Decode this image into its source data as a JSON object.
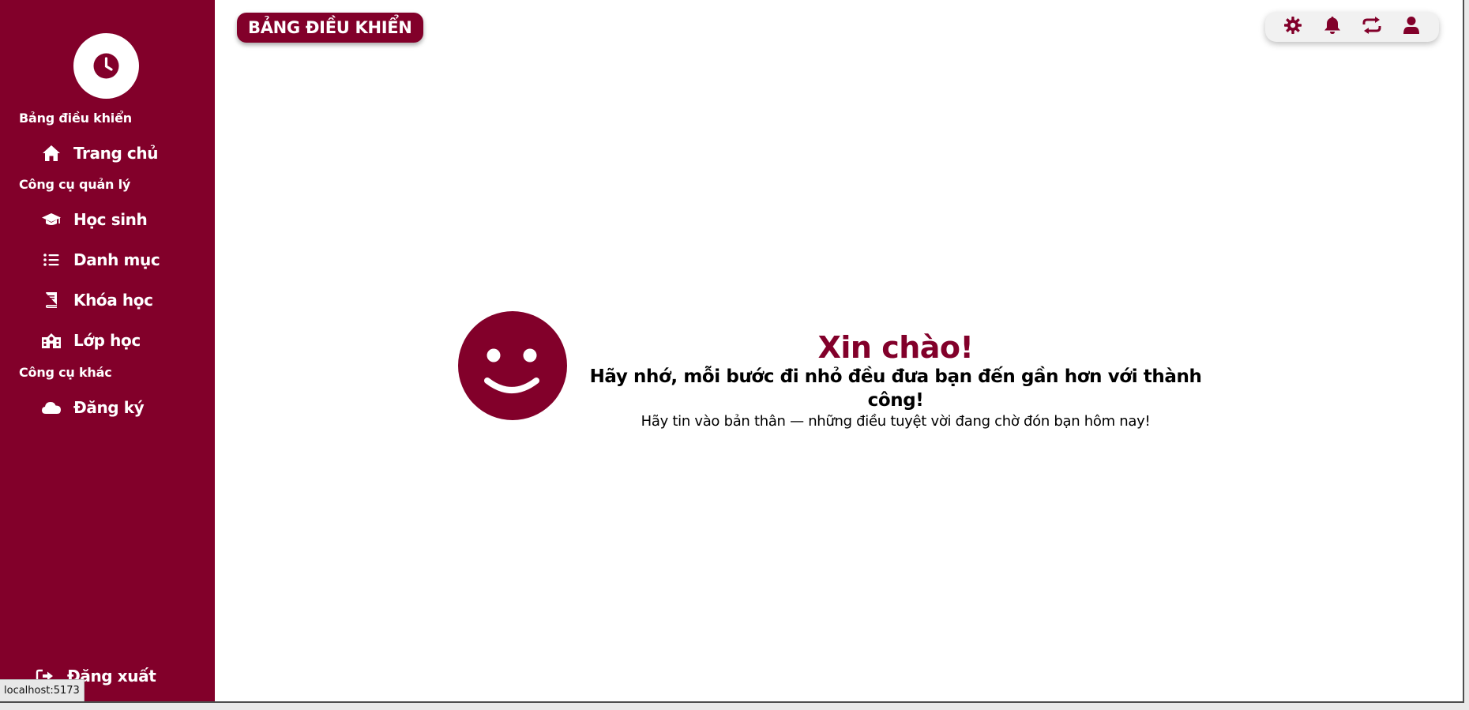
{
  "colors": {
    "brand": "#82002a",
    "background": "#ffffff",
    "toolbar_bg": "#f1f1f1"
  },
  "sidebar": {
    "logo_icon": "clock-icon",
    "sections": {
      "dashboard": "Bảng điều khiển",
      "management": "Công cụ quản lý",
      "other": "Công cụ khác"
    },
    "items": {
      "home": {
        "label": "Trang chủ",
        "icon": "home-icon"
      },
      "students": {
        "label": "Học sinh",
        "icon": "graduation-cap-icon"
      },
      "categories": {
        "label": "Danh mục",
        "icon": "list-icon"
      },
      "courses": {
        "label": "Khóa học",
        "icon": "book-icon"
      },
      "classes": {
        "label": "Lớp học",
        "icon": "school-icon"
      },
      "register": {
        "label": "Đăng ký",
        "icon": "cloud-icon"
      },
      "logout": {
        "label": "Đăng xuất",
        "icon": "logout-icon"
      }
    }
  },
  "header": {
    "title": "BẢNG ĐIỀU KHIỂN",
    "toolbar": [
      "settings-icon",
      "bell-icon",
      "refresh-icon",
      "user-icon"
    ]
  },
  "main": {
    "greeting": "Xin chào!",
    "message": "Hãy nhớ, mỗi bước đi nhỏ đều đưa bạn đến gần hơn với thành công!",
    "submessage": "Hãy tin vào bản thân — những điều tuyệt vời đang chờ đón bạn hôm nay!",
    "smiley_icon": "smiley-icon"
  },
  "status_bar": {
    "url": "localhost:5173"
  }
}
